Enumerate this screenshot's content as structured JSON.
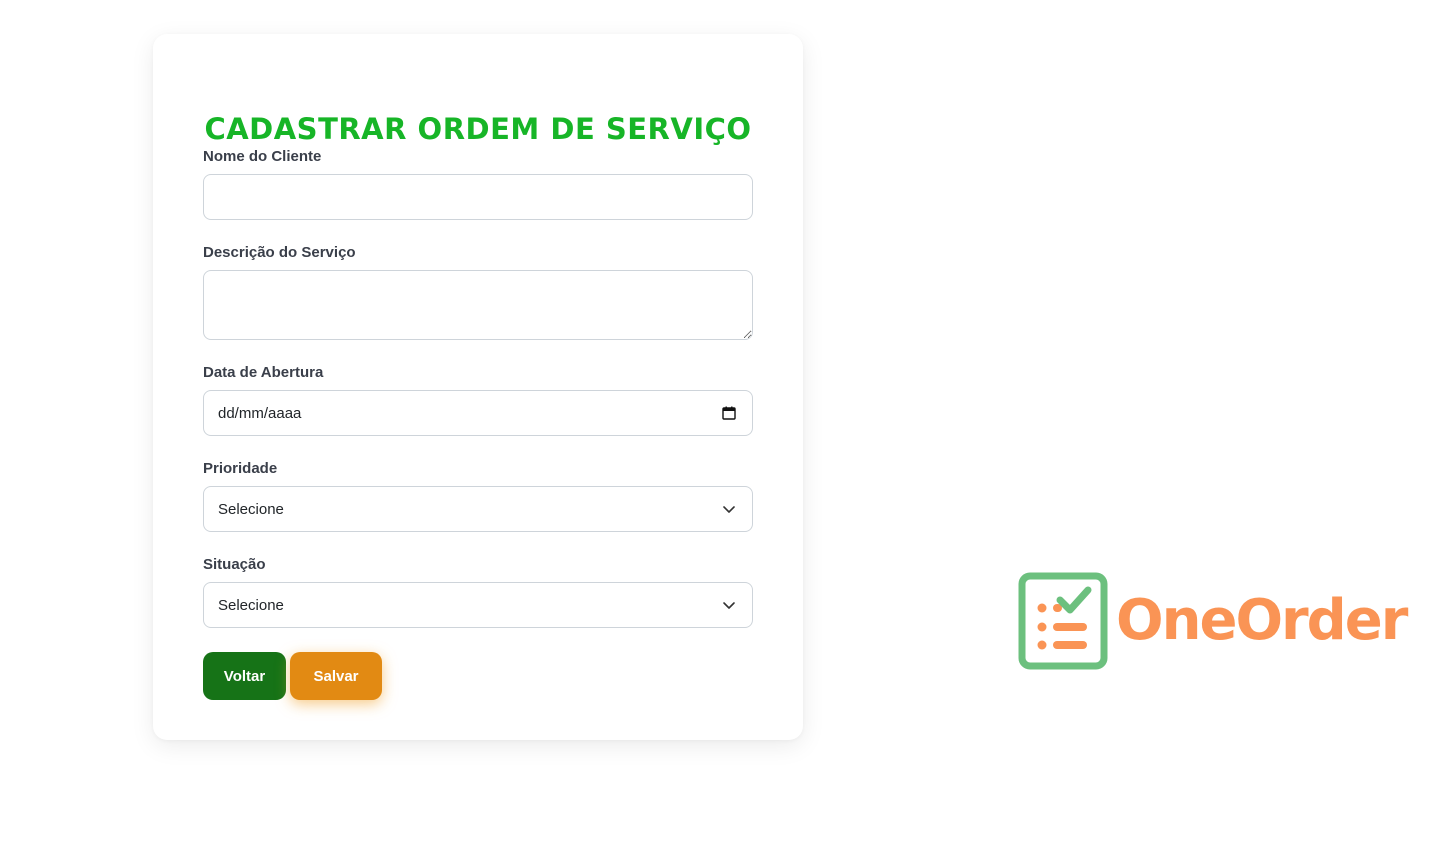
{
  "form": {
    "title": "CADASTRAR ORDEM DE SERVIÇO",
    "client_name": {
      "label": "Nome do Cliente",
      "value": ""
    },
    "description": {
      "label": "Descrição do Serviço",
      "value": ""
    },
    "open_date": {
      "label": "Data de Abertura",
      "placeholder": "dd/mm/aaaa",
      "icon": "calendar-icon"
    },
    "priority": {
      "label": "Prioridade",
      "selected": "Selecione",
      "icon": "chevron-down-icon"
    },
    "status": {
      "label": "Situação",
      "selected": "Selecione",
      "icon": "chevron-down-icon"
    },
    "back_label": "Voltar",
    "save_label": "Salvar"
  },
  "brand": {
    "name": "OneOrder",
    "icon": "checklist-icon",
    "icon_color": "#6cc07e",
    "text_color": "#fa9455"
  },
  "colors": {
    "title": "#17b527",
    "back_button": "#167317",
    "save_button": "#e28a13"
  }
}
